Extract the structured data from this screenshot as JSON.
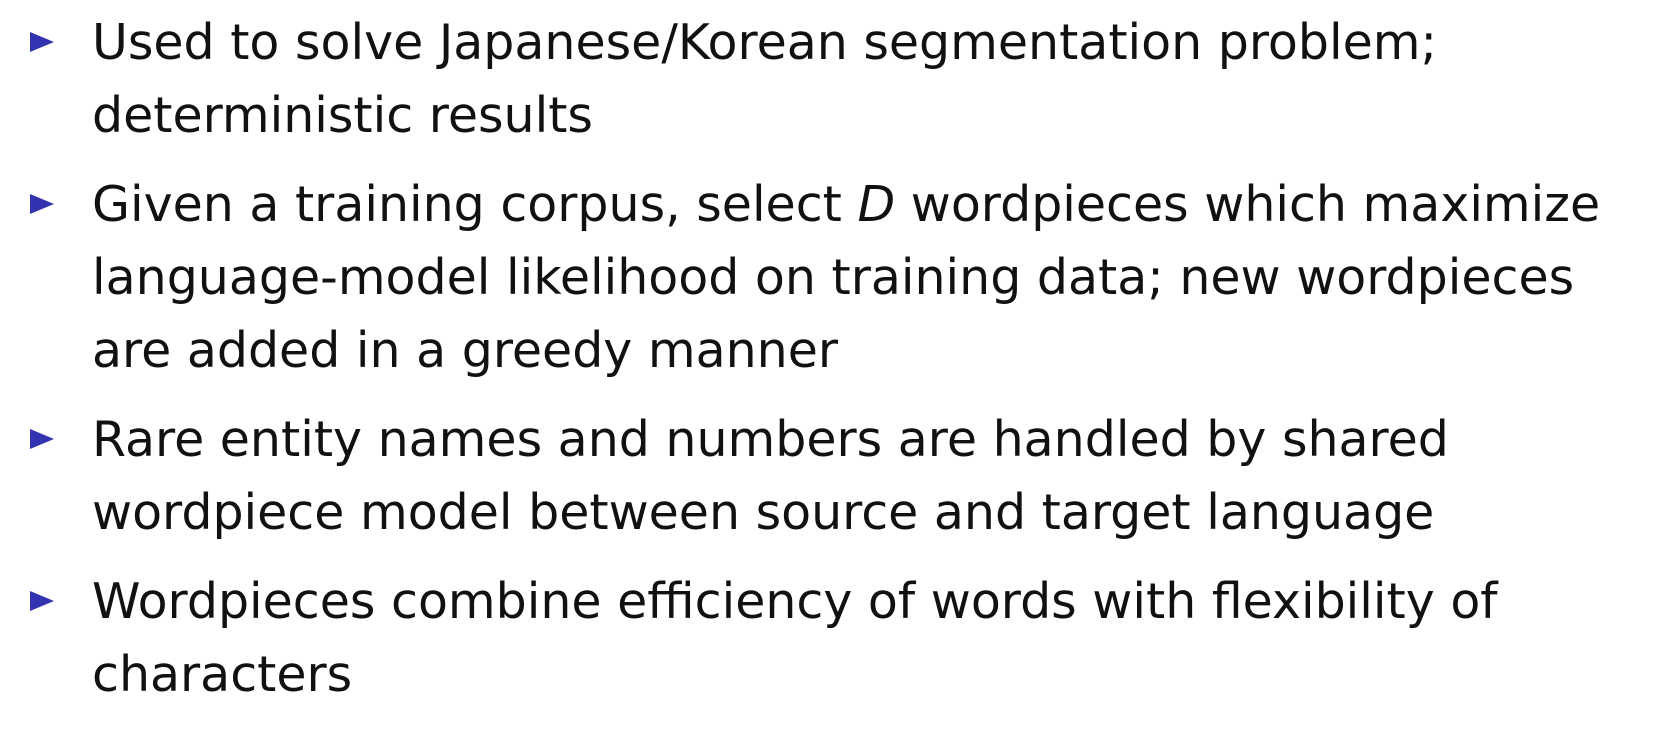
{
  "bullets": [
    {
      "text": "Used to solve Japanese/Korean segmentation problem; deterministic results"
    },
    {
      "text_before": "Given a training corpus, select ",
      "math": "D",
      "text_after": " wordpieces which maximize language-model likelihood on training data; new wordpieces are added in a greedy manner"
    },
    {
      "text": "Rare entity names and numbers are handled by shared wordpiece model between source and target language"
    },
    {
      "text": "Wordpieces combine efficiency of words with flexibility of characters"
    }
  ],
  "colors": {
    "bullet_marker": "#3333b2",
    "text": "#111111",
    "background": "#ffffff"
  },
  "icons": {
    "bullet": "triangle-bullet-icon"
  }
}
